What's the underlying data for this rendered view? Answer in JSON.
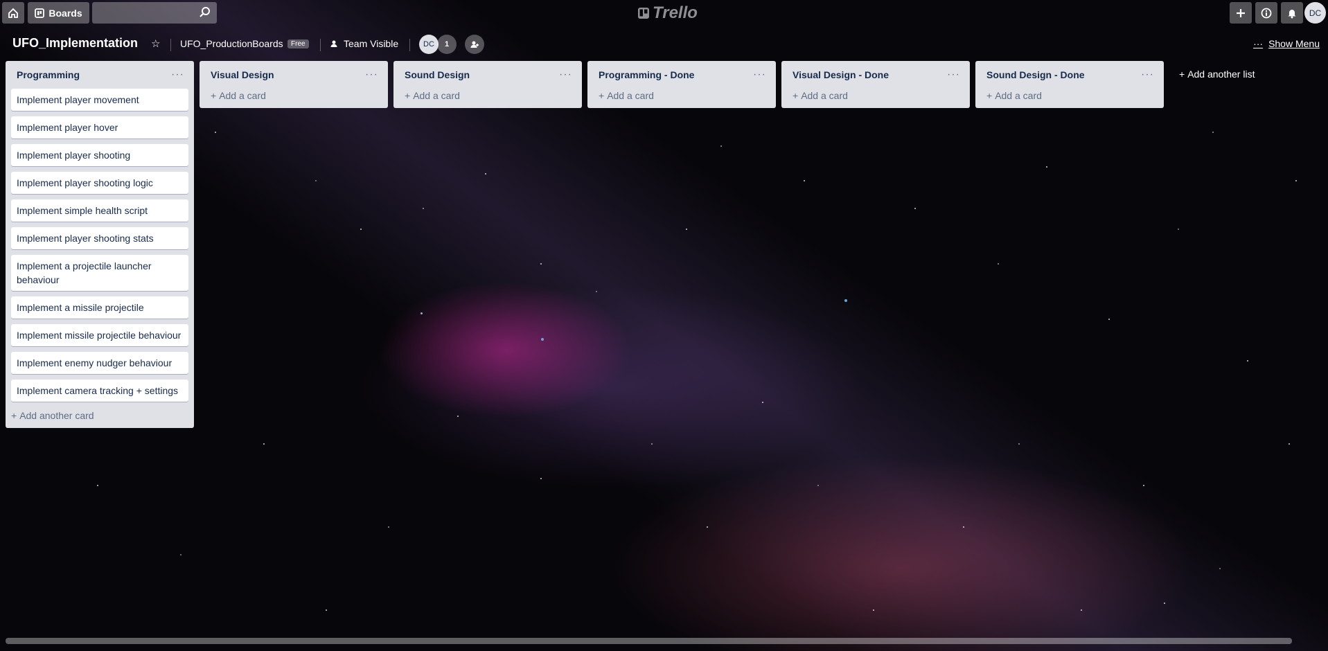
{
  "topbar": {
    "boards_label": "Boards",
    "logo_text": "Trello",
    "user_initials": "DC"
  },
  "board": {
    "title": "UFO_Implementation",
    "team_name": "UFO_ProductionBoards",
    "plan_badge": "Free",
    "visibility": "Team Visible",
    "member_initials": "DC",
    "member_count": "1",
    "show_menu": "Show Menu"
  },
  "lists": [
    {
      "title": "Programming",
      "cards": [
        "Implement player movement",
        "Implement player hover",
        "Implement player shooting",
        "Implement player shooting logic",
        "Implement simple health script",
        "Implement player shooting stats",
        "Implement a projectile launcher behaviour",
        "Implement a missile projectile",
        "Implement missile projectile behaviour",
        "Implement enemy nudger behaviour",
        "Implement camera tracking + settings"
      ],
      "add_label": "Add another card"
    },
    {
      "title": "Visual Design",
      "cards": [],
      "add_label": "Add a card"
    },
    {
      "title": "Sound Design",
      "cards": [],
      "add_label": "Add a card"
    },
    {
      "title": "Programming - Done",
      "cards": [],
      "add_label": "Add a card"
    },
    {
      "title": "Visual Design - Done",
      "cards": [],
      "add_label": "Add a card"
    },
    {
      "title": "Sound Design - Done",
      "cards": [],
      "add_label": "Add a card"
    }
  ],
  "add_list_label": "Add another list",
  "icons": {
    "home": "home-icon",
    "boards": "boards-icon",
    "search": "search-icon",
    "plus": "plus-icon",
    "info": "info-icon",
    "bell": "bell-icon",
    "star": "star-icon",
    "menu_dots": "more-icon"
  }
}
